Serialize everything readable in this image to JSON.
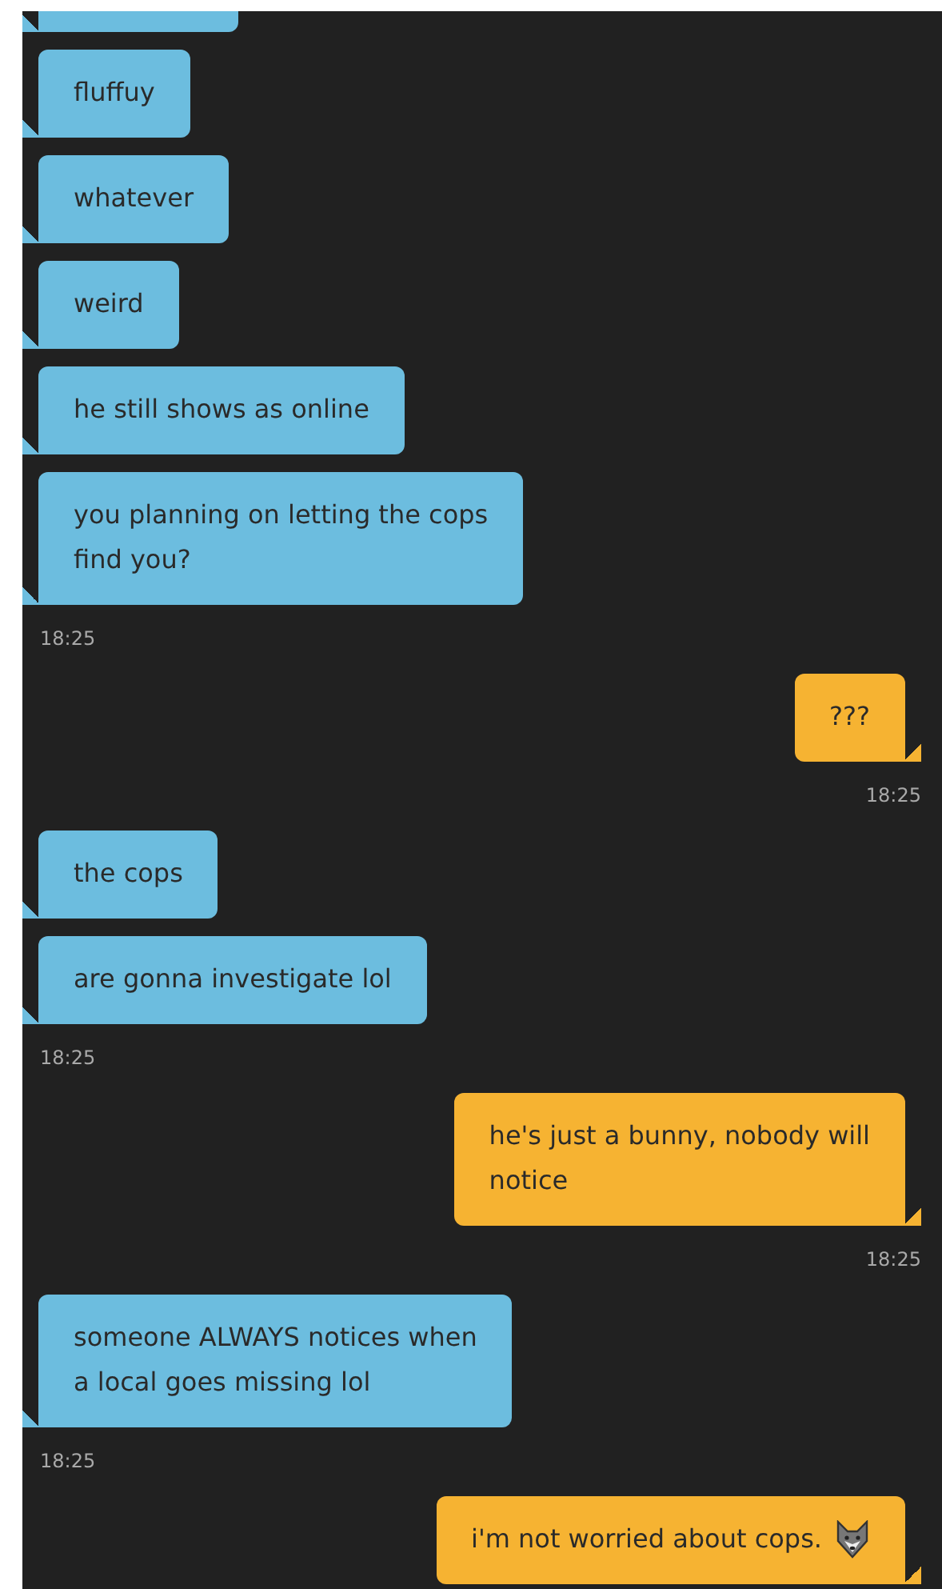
{
  "groups": [
    {
      "kind": "in",
      "messages": [
        {
          "cut": true
        },
        {
          "lines": [
            "fluffuy"
          ]
        },
        {
          "lines": [
            "whatever"
          ]
        },
        {
          "lines": [
            "weird"
          ]
        },
        {
          "lines": [
            "he still shows as online"
          ]
        },
        {
          "lines": [
            "you planning on letting the cops",
            "find you?"
          ]
        }
      ],
      "time_label": "18:25"
    },
    {
      "kind": "out",
      "messages": [
        {
          "lines": [
            "???"
          ]
        }
      ],
      "time_label": "18:25"
    },
    {
      "kind": "in",
      "messages": [
        {
          "lines": [
            "the cops"
          ]
        },
        {
          "lines": [
            "are gonna investigate lol"
          ]
        }
      ],
      "time_label": "18:25"
    },
    {
      "kind": "out",
      "messages": [
        {
          "lines": [
            "he's just a bunny, nobody will",
            "notice"
          ]
        }
      ],
      "time_label": "18:25"
    },
    {
      "kind": "in",
      "messages": [
        {
          "lines": [
            "someone ALWAYS notices when",
            "a local goes missing lol"
          ]
        }
      ],
      "time_label": "18:25"
    },
    {
      "kind": "out",
      "messages": [
        {
          "lines": [
            "i'm not worried about cops."
          ],
          "emoji": true
        }
      ]
    }
  ]
}
